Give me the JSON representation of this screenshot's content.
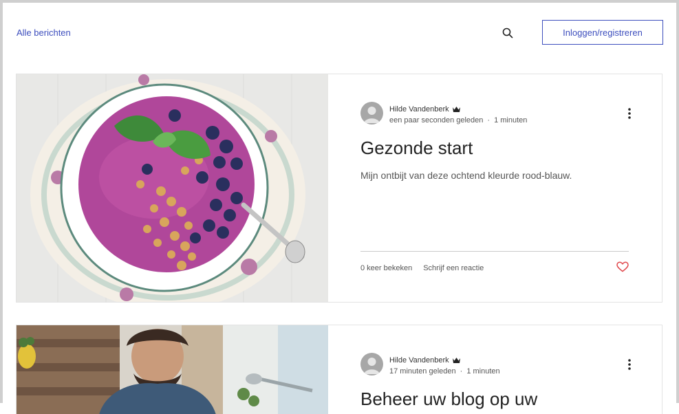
{
  "header": {
    "all_posts_label": "Alle berichten",
    "login_label": "Inloggen/registreren"
  },
  "posts": [
    {
      "author": "Hilde Vandenberk",
      "time_ago": "een paar seconden geleden",
      "read_time": "1 minuten",
      "title": "Gezonde start",
      "excerpt": "Mijn ontbijt van deze ochtend kleurde rood-blauw.",
      "views": "0 keer bekeken",
      "comment_label": "Schrijf een reactie"
    },
    {
      "author": "Hilde Vandenberk",
      "time_ago": "17 minuten geleden",
      "read_time": "1 minuten",
      "title": "Beheer uw blog op uw"
    }
  ],
  "colors": {
    "accent": "#3c4dbd",
    "heart": "#e0474c",
    "border": "#e3e3e3"
  },
  "icons": [
    "search-icon",
    "crown-icon",
    "more-vertical-icon",
    "heart-icon",
    "avatar-placeholder"
  ]
}
